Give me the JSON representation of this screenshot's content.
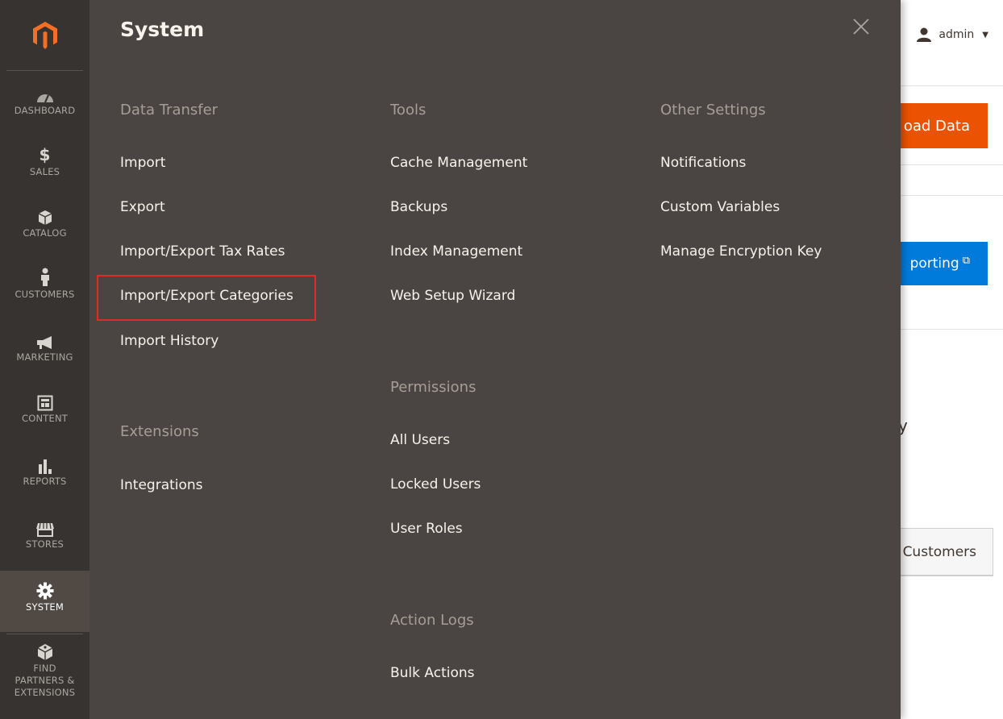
{
  "header": {
    "user_name": "admin"
  },
  "background": {
    "orange_button_label": "oad Data",
    "blue_button_label": "porting",
    "tail_text": "y",
    "tab_label": "Customers"
  },
  "nav": {
    "items": [
      {
        "label": "DASHBOARD",
        "icon": "dashboard-icon"
      },
      {
        "label": "SALES",
        "icon": "dollar-icon"
      },
      {
        "label": "CATALOG",
        "icon": "box-icon"
      },
      {
        "label": "CUSTOMERS",
        "icon": "person-icon"
      },
      {
        "label": "MARKETING",
        "icon": "megaphone-icon"
      },
      {
        "label": "CONTENT",
        "icon": "layout-icon"
      },
      {
        "label": "REPORTS",
        "icon": "bar-chart-icon"
      },
      {
        "label": "STORES",
        "icon": "storefront-icon"
      },
      {
        "label": "SYSTEM",
        "icon": "gear-icon",
        "active": true
      },
      {
        "label": "FIND PARTNERS & EXTENSIONS",
        "icon": "blocks-icon"
      }
    ]
  },
  "flyout": {
    "title": "System",
    "columns": [
      {
        "sections": [
          {
            "heading": "Data Transfer",
            "links": [
              "Import",
              "Export",
              "Import/Export Tax Rates",
              "Import/Export Categories",
              "Import History"
            ]
          },
          {
            "heading": "Extensions",
            "links": [
              "Integrations"
            ]
          }
        ]
      },
      {
        "sections": [
          {
            "heading": "Tools",
            "links": [
              "Cache Management",
              "Backups",
              "Index Management",
              "Web Setup Wizard"
            ]
          },
          {
            "heading": "Permissions",
            "links": [
              "All Users",
              "Locked Users",
              "User Roles"
            ]
          },
          {
            "heading": "Action Logs",
            "links": [
              "Bulk Actions"
            ]
          }
        ]
      },
      {
        "sections": [
          {
            "heading": "Other Settings",
            "links": [
              "Notifications",
              "Custom Variables",
              "Manage Encryption Key"
            ]
          }
        ]
      }
    ]
  },
  "colors": {
    "sidebar_bg": "#373330",
    "flyout_bg": "#4a4542",
    "accent_orange": "#eb5202",
    "logo_orange": "#f46f25",
    "highlight_red": "#e02b27"
  }
}
